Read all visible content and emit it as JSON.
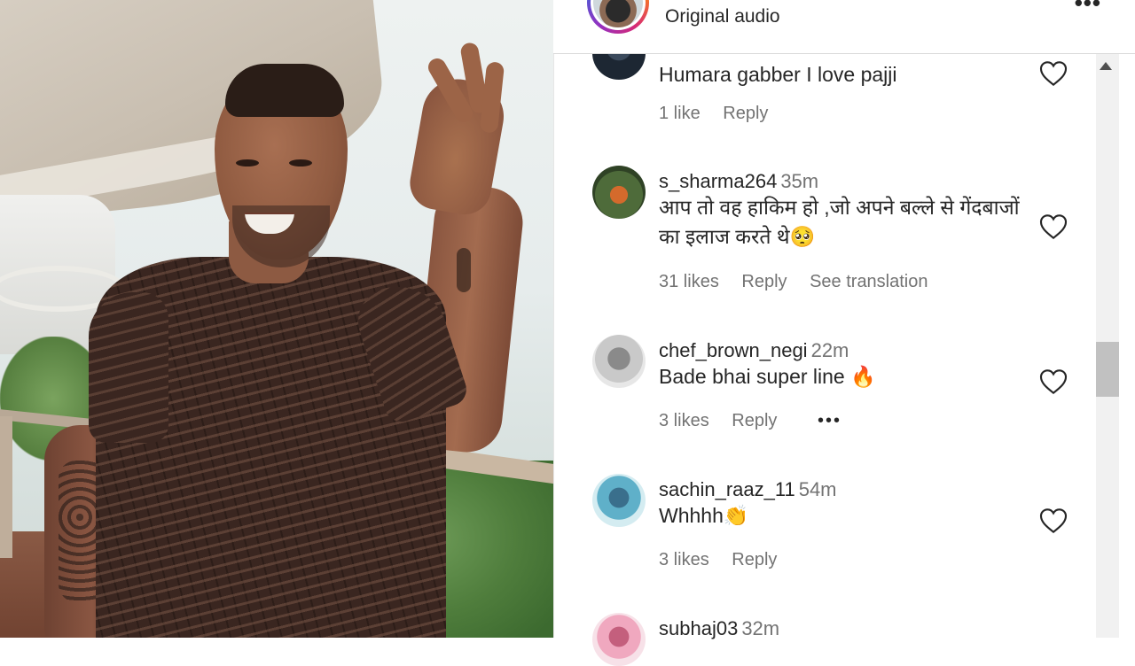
{
  "header": {
    "audio_label": "Original audio",
    "more_icon": "more-icon"
  },
  "comments": [
    {
      "username": "",
      "time": "",
      "text": "Humara gabber I love pajji",
      "likes": "1 like",
      "reply": "Reply"
    },
    {
      "username": "s_sharma264",
      "time": "35m",
      "text": "आप तो वह हाकिम हो ,जो अपने बल्ले से गेंदबाजों का इलाज करते थे🥺",
      "likes": "31 likes",
      "reply": "Reply",
      "translate": "See translation"
    },
    {
      "username": "chef_brown_negi",
      "time": "22m",
      "text": "Bade bhai super line 🔥",
      "likes": "3 likes",
      "reply": "Reply",
      "more": "•••"
    },
    {
      "username": "sachin_raaz_11",
      "time": "54m",
      "text": "Whhhh👏",
      "likes": "3 likes",
      "reply": "Reply"
    },
    {
      "username": "subhaj03",
      "time": "32m",
      "text": "",
      "likes": "",
      "reply": ""
    }
  ],
  "colors": {
    "text": "#262626",
    "secondary": "#737373",
    "divider": "#dbdbdb"
  }
}
